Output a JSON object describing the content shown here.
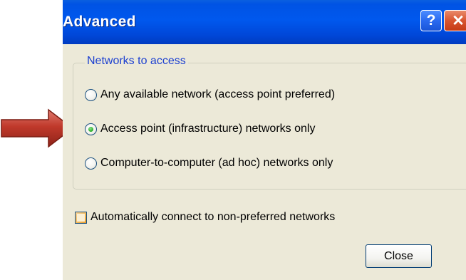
{
  "window": {
    "title": "Advanced",
    "help_glyph": "?",
    "close_glyph": "✕"
  },
  "networks_group": {
    "legend": "Networks to access",
    "options": [
      {
        "label": "Any available network (access point preferred)",
        "selected": false
      },
      {
        "label": "Access point (infrastructure) networks only",
        "selected": true
      },
      {
        "label": "Computer-to-computer (ad hoc) networks only",
        "selected": false
      }
    ]
  },
  "auto_connect": {
    "label": "Automatically connect to non-preferred networks",
    "checked": false
  },
  "buttons": {
    "close_label": "Close"
  },
  "annotation": {
    "arrow_color": "#c0392b",
    "arrow_points_to": "Access point (infrastructure) networks only"
  },
  "colors": {
    "titlebar": "#0058ee",
    "dialog_bg": "#ece9d8",
    "legend_text": "#1b3fd0",
    "radio_selected": "#2fb52f"
  }
}
